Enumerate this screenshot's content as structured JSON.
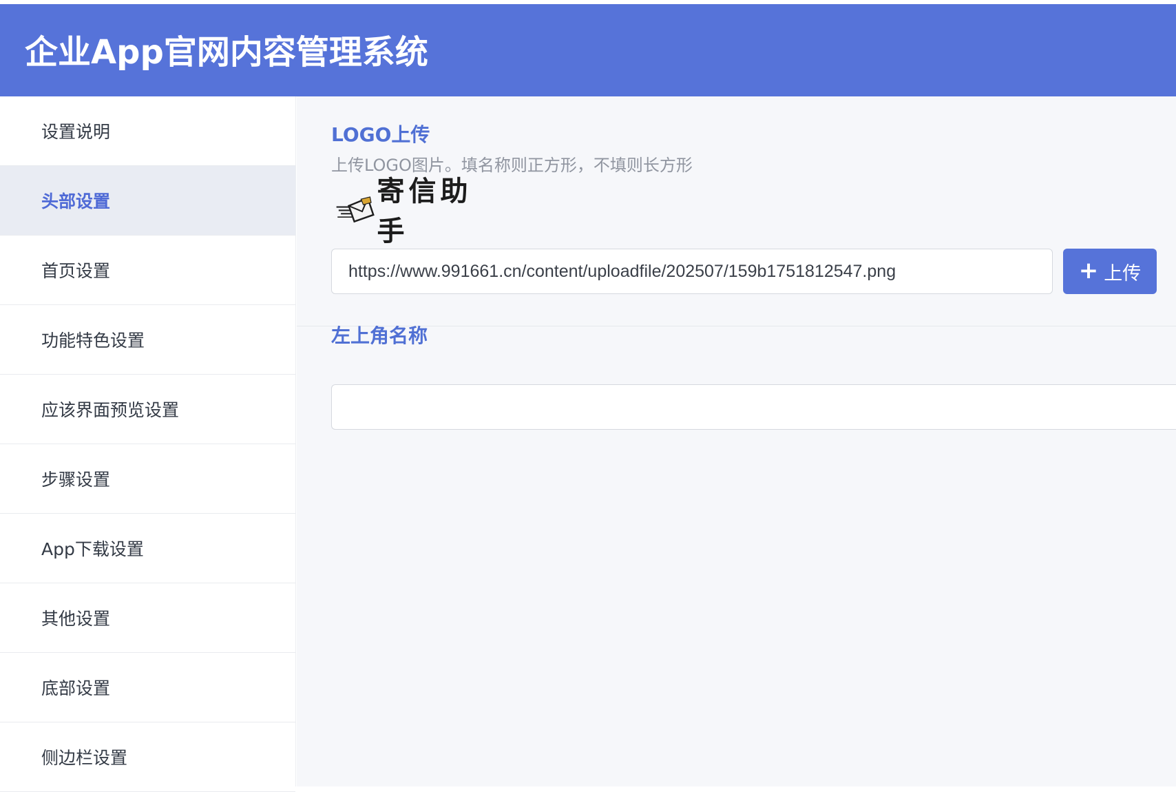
{
  "header": {
    "title": "企业App官网内容管理系统"
  },
  "sidebar": {
    "items": [
      {
        "label": "设置说明",
        "active": false
      },
      {
        "label": "头部设置",
        "active": true
      },
      {
        "label": "首页设置",
        "active": false
      },
      {
        "label": "功能特色设置",
        "active": false
      },
      {
        "label": "应该界面预览设置",
        "active": false
      },
      {
        "label": "步骤设置",
        "active": false
      },
      {
        "label": "App下载设置",
        "active": false
      },
      {
        "label": "其他设置",
        "active": false
      },
      {
        "label": "底部设置",
        "active": false
      },
      {
        "label": "侧边栏设置",
        "active": false
      }
    ]
  },
  "logo_section": {
    "label": "LOGO上传",
    "hint": "上传LOGO图片。填名称则正方形，不填则长方形",
    "preview_text": "寄信助手",
    "url_value": "https://www.991661.cn/content/uploadfile/202507/159b1751812547.png",
    "upload_icon": "plus-icon",
    "upload_label": "上传"
  },
  "name_section": {
    "label": "左上角名称",
    "value": ""
  },
  "colors": {
    "accent": "#5673d9",
    "active_bg": "#e9ecf3",
    "main_bg": "#f6f7fa"
  }
}
